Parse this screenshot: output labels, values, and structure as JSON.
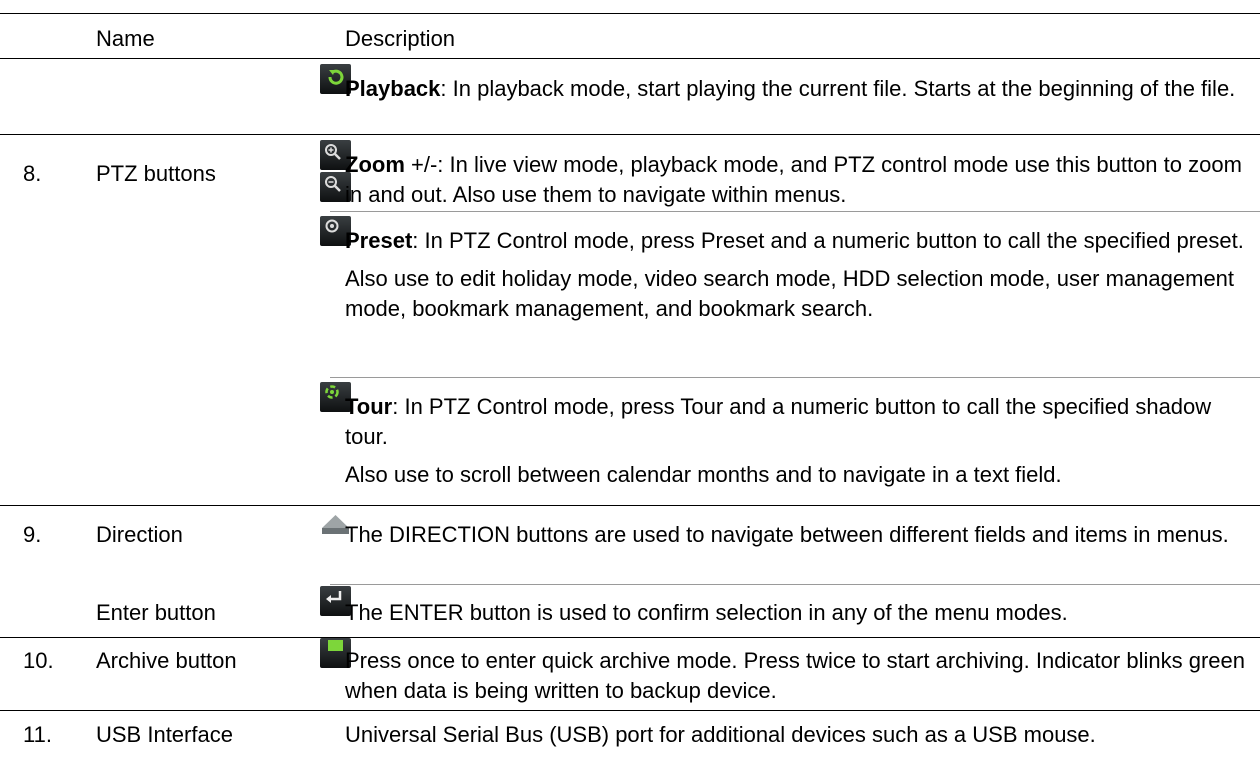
{
  "header": {
    "col_name": "Name",
    "col_description": "Description"
  },
  "rows": [
    {
      "number": "",
      "name": "",
      "icon": "playback-icon",
      "term": "Playback",
      "desc": ": In playback mode, start playing the current file. Starts at the beginning of the file."
    },
    {
      "number": "8.",
      "name": "PTZ buttons",
      "icon": "zoom-icon",
      "term": "Zoom",
      "desc": " +/-: In live view mode, playback mode, and PTZ control mode use this button to zoom in and out. Also use them to navigate within menus."
    },
    {
      "number": "",
      "name": "",
      "icon": "preset-icon",
      "term": "Preset",
      "desc": ": In PTZ Control mode, press Preset and a numeric button to call the specified preset.",
      "desc2": "Also use to edit holiday mode, video search mode, HDD selection mode, user management mode, bookmark management, and bookmark search."
    },
    {
      "number": "",
      "name": "",
      "icon": "tour-icon",
      "term": "Tour",
      "desc": ": In PTZ Control mode, press Tour and a numeric button to call the specified shadow tour.",
      "desc2": "Also use to scroll between calendar months and to navigate in a text field."
    },
    {
      "number": "9.",
      "name": "Direction",
      "icon": "direction-up-icon",
      "desc": "The DIRECTION buttons are used to navigate between different fields and items in menus."
    },
    {
      "number": "",
      "name": "Enter button",
      "icon": "enter-icon",
      "desc": "The ENTER button is used to confirm selection in any of the menu modes."
    },
    {
      "number": "10.",
      "name": "Archive button",
      "icon": "archive-icon",
      "desc": "Press once to enter quick archive mode. Press twice to start archiving. Indicator blinks green when data is being written to backup device."
    },
    {
      "number": "11.",
      "name": "USB Interface",
      "desc": "Universal Serial Bus (USB) port for additional devices such as a USB mouse."
    }
  ],
  "colors": {
    "icon_bg_top": "#3a3f42",
    "icon_bg_bottom": "#0e1011",
    "icon_green": "#7dd63a",
    "rule": "#000000",
    "rule_light": "#9a9a9a"
  }
}
